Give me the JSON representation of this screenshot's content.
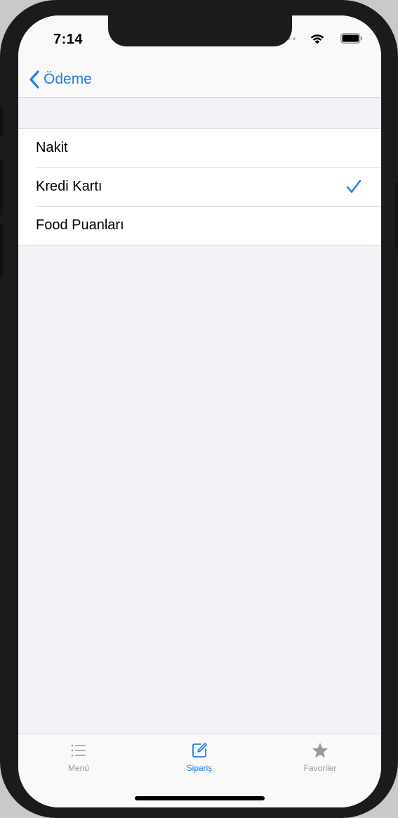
{
  "status_bar": {
    "time": "7:14"
  },
  "nav": {
    "back_label": "Ödeme"
  },
  "payment_options": [
    {
      "label": "Nakit",
      "selected": false
    },
    {
      "label": "Kredi Kartı",
      "selected": true
    },
    {
      "label": "Food Puanları",
      "selected": false
    }
  ],
  "tab_bar": {
    "tabs": [
      {
        "label": "Menü",
        "icon": "list-icon",
        "active": false
      },
      {
        "label": "Sipariş",
        "icon": "compose-icon",
        "active": true
      },
      {
        "label": "Favoriler",
        "icon": "star-icon",
        "active": false
      }
    ]
  },
  "colors": {
    "accent": "#1f7ce6",
    "inactive_tab": "#999999",
    "background": "#f2f2f7"
  }
}
